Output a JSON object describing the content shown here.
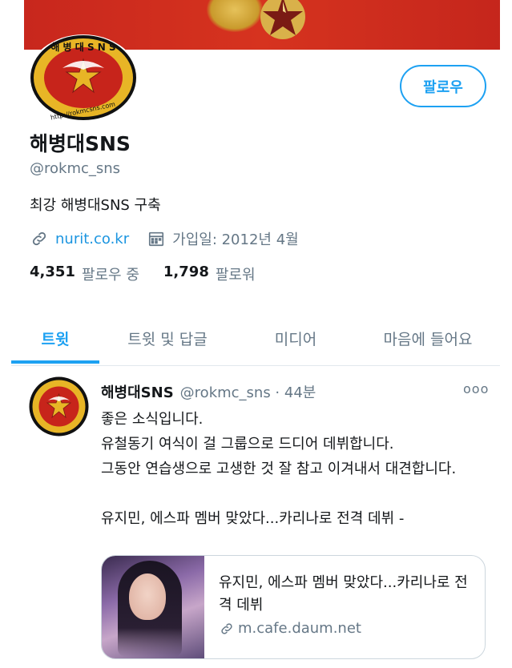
{
  "profile": {
    "follow_label": "팔로우",
    "name": "해병대SNS",
    "handle": "@rokmc_sns",
    "bio": "최강 해병대SNS 구축",
    "link": "nurit.co.kr",
    "joined": "가입일: 2012년 4월",
    "following_count": "4,351",
    "following_label": "팔로우 중",
    "followers_count": "1,798",
    "followers_label": "팔로워",
    "avatar_ring_text": "해 병 대 S N S",
    "avatar_url_text": "http://rokmcsns.com"
  },
  "tabs": [
    {
      "label": "트윗",
      "active": true
    },
    {
      "label": "트윗 및 답글",
      "active": false
    },
    {
      "label": "미디어",
      "active": false
    },
    {
      "label": "마음에 들어요",
      "active": false
    }
  ],
  "tweet": {
    "name": "해병대SNS",
    "handle_time": "@rokmc_sns · 44분",
    "more": "ooo",
    "body": "좋은 소식입니다.\n유철동기 여식이 걸 그룹으로 드디어 데뷔합니다.\n그동안 연습생으로 고생한 것 잘 참고 이겨내서 대견합니다.\n\n유지민, 에스파 멤버 맞았다...카리나로 전격 데뷔 -",
    "card": {
      "title": "유지민, 에스파 멤버 맞았다...카리나로 전격 데뷔",
      "url": "m.cafe.daum.net"
    }
  },
  "colors": {
    "accent": "#1da1f2",
    "link": "#1b95e0",
    "muted": "#657786",
    "banner": "#c8271d"
  },
  "icons": [
    "link-icon",
    "calendar-icon",
    "more-icon"
  ]
}
